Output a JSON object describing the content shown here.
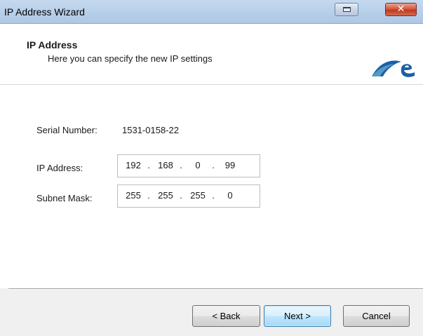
{
  "window": {
    "title": "IP Address Wizard"
  },
  "header": {
    "title": "IP Address",
    "subtitle": "Here you can specify the new IP settings",
    "logo_icon": "brand-logo-icon"
  },
  "form": {
    "serial_label": "Serial Number:",
    "serial_value": "1531-0158-22",
    "ip_label": "IP Address:",
    "ip_octets": [
      "192",
      "168",
      "0",
      "99"
    ],
    "subnet_label": "Subnet Mask:",
    "subnet_octets": [
      "255",
      "255",
      "255",
      "0"
    ]
  },
  "buttons": {
    "back_label": "< Back",
    "next_label": "Next >",
    "cancel_label": "Cancel"
  },
  "colors": {
    "titlebar": "#b9d1ea",
    "close_button": "#c0391f",
    "default_button_border": "#3c7fb1",
    "logo_blue": "#1b5fa8",
    "logo_teal": "#5fa3c9"
  }
}
